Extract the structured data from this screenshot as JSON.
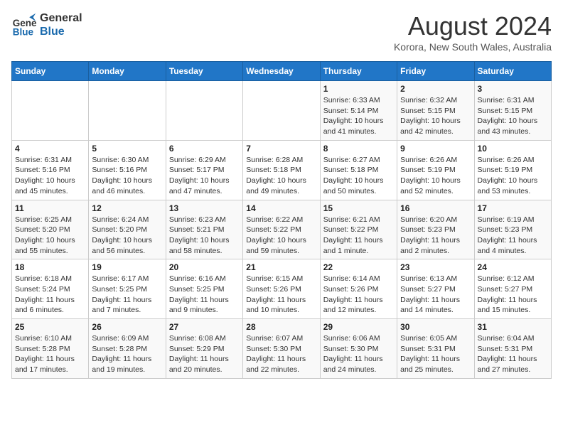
{
  "logo": {
    "line1": "General",
    "line2": "Blue"
  },
  "title": "August 2024",
  "subtitle": "Korora, New South Wales, Australia",
  "days_header": [
    "Sunday",
    "Monday",
    "Tuesday",
    "Wednesday",
    "Thursday",
    "Friday",
    "Saturday"
  ],
  "weeks": [
    [
      {
        "num": "",
        "info": ""
      },
      {
        "num": "",
        "info": ""
      },
      {
        "num": "",
        "info": ""
      },
      {
        "num": "",
        "info": ""
      },
      {
        "num": "1",
        "info": "Sunrise: 6:33 AM\nSunset: 5:14 PM\nDaylight: 10 hours and 41 minutes."
      },
      {
        "num": "2",
        "info": "Sunrise: 6:32 AM\nSunset: 5:15 PM\nDaylight: 10 hours and 42 minutes."
      },
      {
        "num": "3",
        "info": "Sunrise: 6:31 AM\nSunset: 5:15 PM\nDaylight: 10 hours and 43 minutes."
      }
    ],
    [
      {
        "num": "4",
        "info": "Sunrise: 6:31 AM\nSunset: 5:16 PM\nDaylight: 10 hours and 45 minutes."
      },
      {
        "num": "5",
        "info": "Sunrise: 6:30 AM\nSunset: 5:16 PM\nDaylight: 10 hours and 46 minutes."
      },
      {
        "num": "6",
        "info": "Sunrise: 6:29 AM\nSunset: 5:17 PM\nDaylight: 10 hours and 47 minutes."
      },
      {
        "num": "7",
        "info": "Sunrise: 6:28 AM\nSunset: 5:18 PM\nDaylight: 10 hours and 49 minutes."
      },
      {
        "num": "8",
        "info": "Sunrise: 6:27 AM\nSunset: 5:18 PM\nDaylight: 10 hours and 50 minutes."
      },
      {
        "num": "9",
        "info": "Sunrise: 6:26 AM\nSunset: 5:19 PM\nDaylight: 10 hours and 52 minutes."
      },
      {
        "num": "10",
        "info": "Sunrise: 6:26 AM\nSunset: 5:19 PM\nDaylight: 10 hours and 53 minutes."
      }
    ],
    [
      {
        "num": "11",
        "info": "Sunrise: 6:25 AM\nSunset: 5:20 PM\nDaylight: 10 hours and 55 minutes."
      },
      {
        "num": "12",
        "info": "Sunrise: 6:24 AM\nSunset: 5:20 PM\nDaylight: 10 hours and 56 minutes."
      },
      {
        "num": "13",
        "info": "Sunrise: 6:23 AM\nSunset: 5:21 PM\nDaylight: 10 hours and 58 minutes."
      },
      {
        "num": "14",
        "info": "Sunrise: 6:22 AM\nSunset: 5:22 PM\nDaylight: 10 hours and 59 minutes."
      },
      {
        "num": "15",
        "info": "Sunrise: 6:21 AM\nSunset: 5:22 PM\nDaylight: 11 hours and 1 minute."
      },
      {
        "num": "16",
        "info": "Sunrise: 6:20 AM\nSunset: 5:23 PM\nDaylight: 11 hours and 2 minutes."
      },
      {
        "num": "17",
        "info": "Sunrise: 6:19 AM\nSunset: 5:23 PM\nDaylight: 11 hours and 4 minutes."
      }
    ],
    [
      {
        "num": "18",
        "info": "Sunrise: 6:18 AM\nSunset: 5:24 PM\nDaylight: 11 hours and 6 minutes."
      },
      {
        "num": "19",
        "info": "Sunrise: 6:17 AM\nSunset: 5:25 PM\nDaylight: 11 hours and 7 minutes."
      },
      {
        "num": "20",
        "info": "Sunrise: 6:16 AM\nSunset: 5:25 PM\nDaylight: 11 hours and 9 minutes."
      },
      {
        "num": "21",
        "info": "Sunrise: 6:15 AM\nSunset: 5:26 PM\nDaylight: 11 hours and 10 minutes."
      },
      {
        "num": "22",
        "info": "Sunrise: 6:14 AM\nSunset: 5:26 PM\nDaylight: 11 hours and 12 minutes."
      },
      {
        "num": "23",
        "info": "Sunrise: 6:13 AM\nSunset: 5:27 PM\nDaylight: 11 hours and 14 minutes."
      },
      {
        "num": "24",
        "info": "Sunrise: 6:12 AM\nSunset: 5:27 PM\nDaylight: 11 hours and 15 minutes."
      }
    ],
    [
      {
        "num": "25",
        "info": "Sunrise: 6:10 AM\nSunset: 5:28 PM\nDaylight: 11 hours and 17 minutes."
      },
      {
        "num": "26",
        "info": "Sunrise: 6:09 AM\nSunset: 5:28 PM\nDaylight: 11 hours and 19 minutes."
      },
      {
        "num": "27",
        "info": "Sunrise: 6:08 AM\nSunset: 5:29 PM\nDaylight: 11 hours and 20 minutes."
      },
      {
        "num": "28",
        "info": "Sunrise: 6:07 AM\nSunset: 5:30 PM\nDaylight: 11 hours and 22 minutes."
      },
      {
        "num": "29",
        "info": "Sunrise: 6:06 AM\nSunset: 5:30 PM\nDaylight: 11 hours and 24 minutes."
      },
      {
        "num": "30",
        "info": "Sunrise: 6:05 AM\nSunset: 5:31 PM\nDaylight: 11 hours and 25 minutes."
      },
      {
        "num": "31",
        "info": "Sunrise: 6:04 AM\nSunset: 5:31 PM\nDaylight: 11 hours and 27 minutes."
      }
    ]
  ]
}
